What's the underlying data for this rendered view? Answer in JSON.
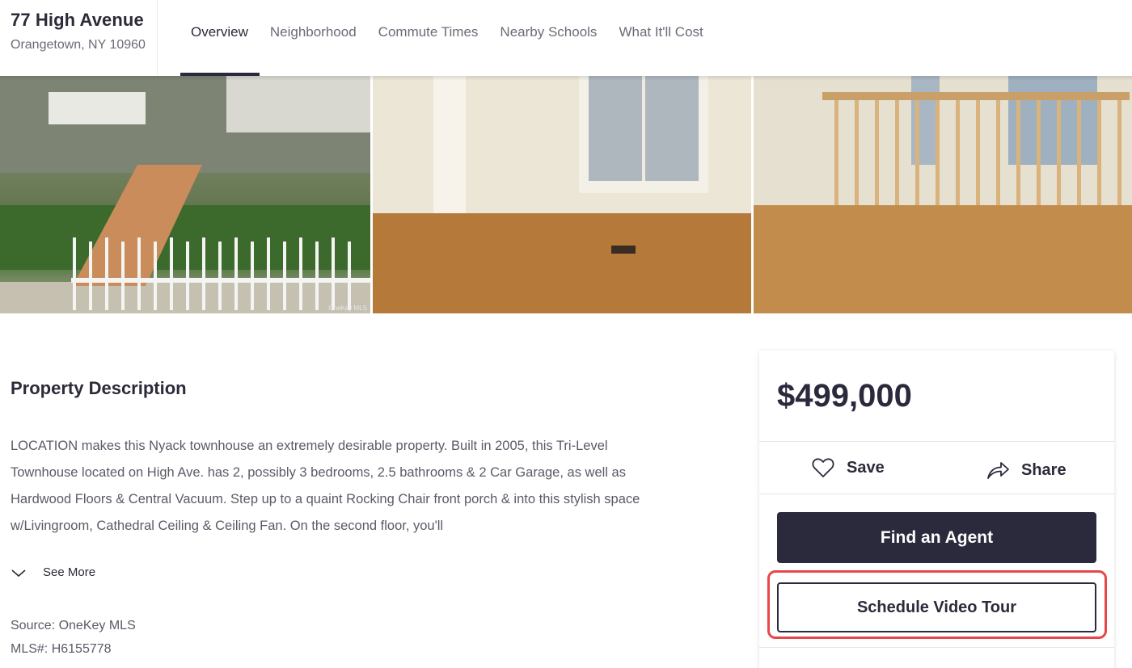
{
  "header": {
    "street": "77 High Avenue",
    "city": "Orangetown, NY 10960",
    "tabs": [
      {
        "label": "Overview",
        "active": true
      },
      {
        "label": "Neighborhood",
        "active": false
      },
      {
        "label": "Commute Times",
        "active": false
      },
      {
        "label": "Nearby Schools",
        "active": false
      },
      {
        "label": "What It'll Cost",
        "active": false
      }
    ]
  },
  "photos": {
    "credit": "OneKey MLS"
  },
  "description": {
    "title": "Property Description",
    "text": "LOCATION makes this Nyack townhouse an extremely desirable property. Built in 2005, this Tri-Level Townhouse located on High Ave. has 2, possibly 3 bedrooms, 2.5 bathrooms & 2 Car Garage, as well as Hardwood Floors & Central Vacuum. Step up to a quaint Rocking Chair front porch & into this stylish space w/Livingroom, Cathedral Ceiling & Ceiling Fan. On the second floor, you'll",
    "see_more_label": "See More",
    "source": "Source: OneKey MLS",
    "mls": "MLS#: H6155778"
  },
  "card": {
    "price": "$499,000",
    "save_label": "Save",
    "share_label": "Share",
    "find_agent_label": "Find an Agent",
    "schedule_tour_label": "Schedule Video Tour"
  },
  "colors": {
    "brand_dark": "#2b2a3d",
    "highlight": "#e8474a"
  }
}
